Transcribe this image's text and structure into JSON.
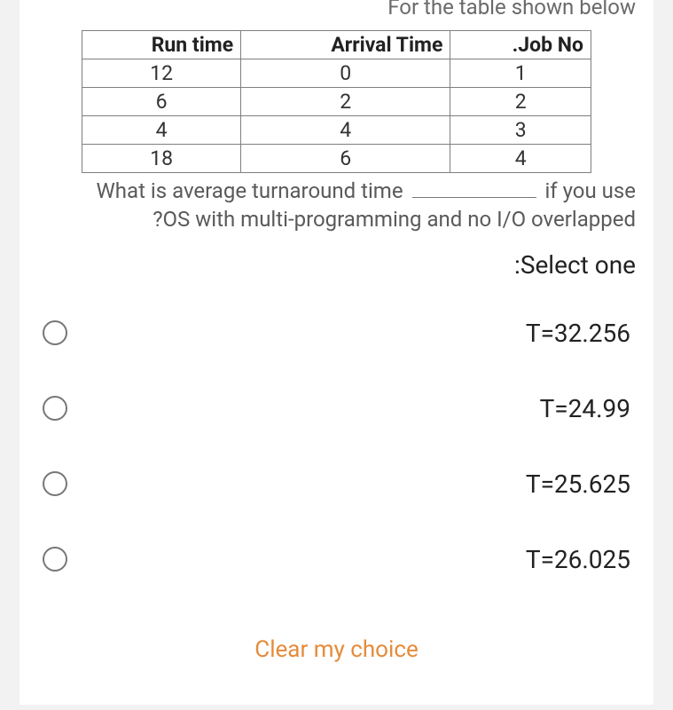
{
  "intro": "For the table shown below",
  "table": {
    "headers": [
      "Run time",
      "Arrival Time",
      ".Job No"
    ],
    "rows": [
      [
        "12",
        "0",
        "1"
      ],
      [
        "6",
        "2",
        "2"
      ],
      [
        "4",
        "4",
        "3"
      ],
      [
        "18",
        "6",
        "4"
      ]
    ]
  },
  "question_line1_pre": "What is average turnaround time",
  "question_line1_post": "if you use",
  "question_line2": "?OS with multi-programming and no I/O overlapped",
  "select_one": ":Select one",
  "options": [
    "T=32.256",
    "T=24.99",
    "T=25.625",
    "T=26.025"
  ],
  "clear": "Clear my choice"
}
